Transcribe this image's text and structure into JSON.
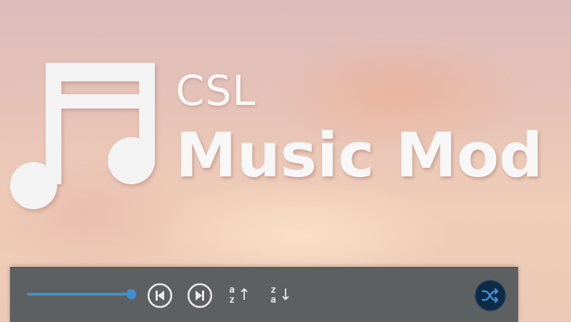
{
  "app": {
    "title_small": "CSL",
    "title_big": "Music Mod"
  },
  "player": {
    "volume": 1.0,
    "sort_asc": {
      "top": "a",
      "bottom": "z",
      "arrow": "↑"
    },
    "sort_desc": {
      "top": "z",
      "bottom": "a",
      "arrow": "↓"
    },
    "icons": {
      "logo": "music-note-icon",
      "previous": "skip-previous-icon",
      "next": "skip-next-icon",
      "shuffle": "shuffle-icon"
    }
  },
  "colors": {
    "accent": "#3e8fd3",
    "bar": "#5d6061",
    "shuffle_bg": "#0f2a45"
  }
}
